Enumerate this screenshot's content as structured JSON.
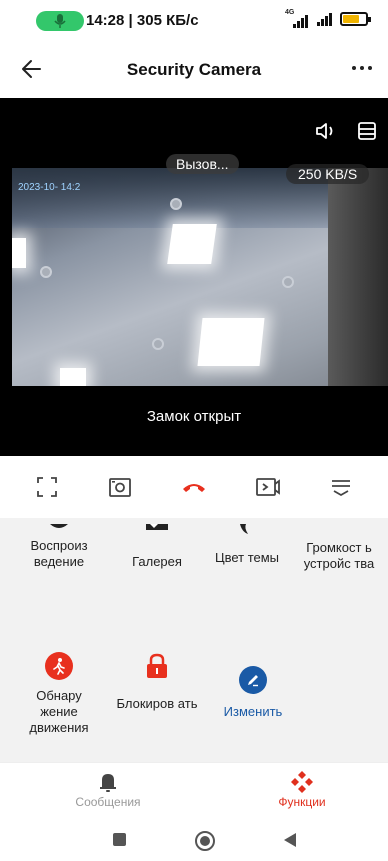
{
  "status_bar": {
    "time_speed": "14:28 | 305 КБ/с",
    "network": "4G",
    "accent": "#33c76b"
  },
  "header": {
    "title": "Security Camera",
    "back_icon": "arrow-left-icon",
    "more_icon": "more-dots-icon"
  },
  "video": {
    "timestamp": "2023-10-   14:2",
    "calling": "Вызов...",
    "bitrate": "250 KB/S",
    "lock_status": "Замок открыт",
    "speaker_icon": "speaker-icon",
    "layout_icon": "layout-icon"
  },
  "controls": [
    {
      "name": "fullscreen-icon"
    },
    {
      "name": "snapshot-icon"
    },
    {
      "name": "hangup-icon"
    },
    {
      "name": "record-icon"
    },
    {
      "name": "collapse-icon"
    }
  ],
  "functions": {
    "playback": "Воспроиз ведение",
    "gallery": "Галерея",
    "theme_color": "Цвет темы",
    "volume": "Громкост ь устройс тва",
    "motion": "Обнару жение движения",
    "lock": "Блокиров ать",
    "edit": "Изменить"
  },
  "bottom_nav": {
    "messages": "Сообщения",
    "functions": "Функции",
    "active_color": "#e0301e"
  },
  "colors": {
    "red": "#e8301e",
    "blue": "#1a5aa6"
  }
}
